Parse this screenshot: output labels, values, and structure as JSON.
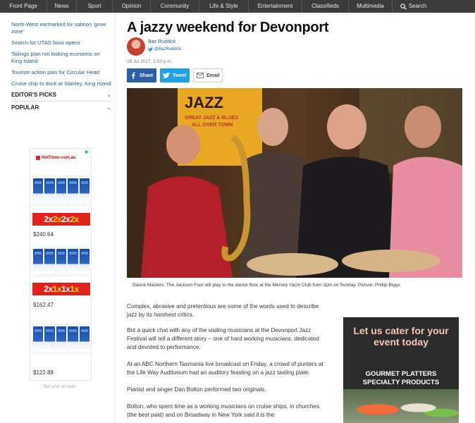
{
  "nav": {
    "items": [
      "Front Page",
      "News",
      "Sport",
      "Opinion",
      "Community",
      "Life & Style",
      "Entertainment",
      "Classifieds",
      "Multimedia"
    ],
    "search_label": "Search"
  },
  "sidebar": {
    "links": [
      "North-West earmarked for salmon 'grow zone'",
      "Search for UTAS boss opens",
      "Tailings plan not looking economic on King Island",
      "Tourism action plan for Circular Head",
      "Cruise ship to dock at Stanley, King Island"
    ],
    "sections": [
      "EDITOR'S PICKS",
      "POPULAR"
    ]
  },
  "ad": {
    "brand": "HotToner.com.au",
    "deals": [
      {
        "text": "2x2x2x2x",
        "price": "$240.64"
      },
      {
        "text": "2x1x1x1x",
        "price": "$162.47"
      },
      {
        "text": "",
        "price": "$122.88"
      }
    ],
    "caption": "See your ad here"
  },
  "article": {
    "title": "A jazzy weekend for Devonport",
    "author": "Baz Ruddick",
    "handle": "@BazRuddick",
    "date": "28 Jul 2017, 2:53 p.m.",
    "share": {
      "facebook": "Share",
      "twitter": "Tweet",
      "email": "Email"
    },
    "photo": {
      "banner_title": "JAZZ",
      "banner_sub1": "GREAT JAZZ & BLUES",
      "banner_sub2": "ALL OVER TOWN"
    },
    "caption": "Dance Masters: The Jackson Four will play to the dance floor at the Mersey Yacht Club from 2pm on Sunday. Picture: Phillip Biggs",
    "paragraphs": [
      "Complex, abrasive and pretentious are some of the words used to describe jazz by its harshest critics.",
      "But a quick chat with any of the visiting musicians at the Devonport Jazz Festival will tell a different story – one of hard working musicians, dedicated and devoted to performance.",
      "At an ABC Northern Tasmania live broadcast on Friday, a crowd of punters at the Life Way Auditorium had an auditory feasting on a jazz tasting plate.",
      "Pianist and singer Dan Bolton performed two originals.",
      "Bolton, who spent time as a working musicians on cruise ships, in churches (the best paid) and on Broadway in New York said it is the"
    ]
  },
  "side_ad": {
    "headline": "Let us cater for your event today",
    "sub1": "GOURMET PLATTERS",
    "sub2": "SPECIALTY PRODUCTS"
  },
  "colors": {
    "nav_bg": "#3b3b3b",
    "link": "#1d5c99",
    "facebook": "#2d5fa9",
    "twitter": "#1fa1e6",
    "deal_red": "#e3211b"
  }
}
